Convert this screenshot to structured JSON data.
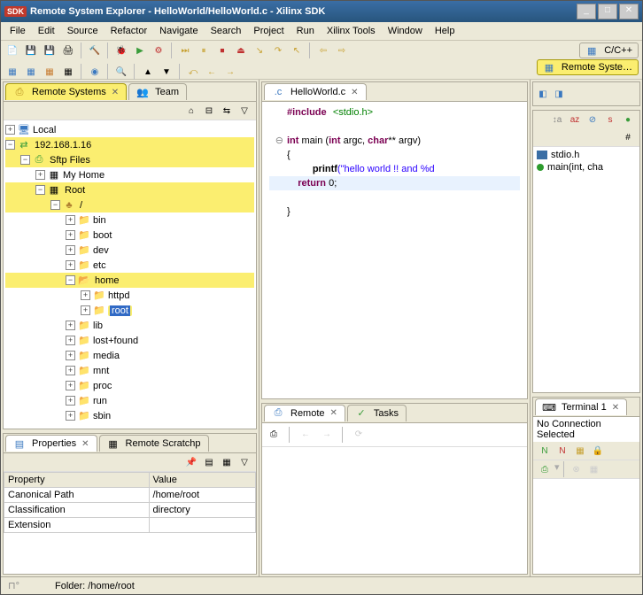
{
  "window": {
    "title": "Remote System Explorer - HelloWorld/HelloWorld.c - Xilinx SDK",
    "badge": "SDK"
  },
  "menu": [
    "File",
    "Edit",
    "Source",
    "Refactor",
    "Navigate",
    "Search",
    "Project",
    "Run",
    "Xilinx Tools",
    "Window",
    "Help"
  ],
  "perspectives": {
    "cpp": "C/C++",
    "remote": "Remote Syste…"
  },
  "left_tabs": {
    "remote": "Remote Systems",
    "team": "Team"
  },
  "tree": {
    "local": "Local",
    "ip": "192.168.1.16",
    "sftp": "Sftp Files",
    "myhome": "My Home",
    "root": "Root",
    "slash": ".",
    "folders": [
      "bin",
      "boot",
      "dev",
      "etc",
      "home",
      "httpd",
      "root",
      "lib",
      "lost+found",
      "media",
      "mnt",
      "proc",
      "run",
      "sbin"
    ]
  },
  "props_tabs": {
    "props": "Properties",
    "scratch": "Remote Scratchp"
  },
  "props": {
    "h_prop": "Property",
    "h_val": "Value",
    "r1_p": "Canonical Path",
    "r1_v": "/home/root",
    "r2_p": "Classification",
    "r2_v": "directory",
    "r3_p": "Extension",
    "r3_v": ""
  },
  "editor": {
    "tab": "HelloWorld.c",
    "include": "#include",
    "stdio": "<stdio.h>",
    "int": "int",
    "main": " main (",
    "argc": " argc, ",
    "char": "char",
    "argv": "** argv)",
    "brace_o": "{",
    "printf": "printf",
    "pargs": "(\"hello world !! and %d",
    "return": "return",
    "zero": " 0;",
    "brace_c": "}"
  },
  "bottom_tabs": {
    "remote": "Remote",
    "tasks": "Tasks",
    "term": "Terminal 1"
  },
  "terminal": {
    "noconn": "No Connection Selected"
  },
  "outline": {
    "h1": "stdio.h",
    "h2": "main(int, cha"
  },
  "status": {
    "folder": "Folder: /home/root"
  }
}
